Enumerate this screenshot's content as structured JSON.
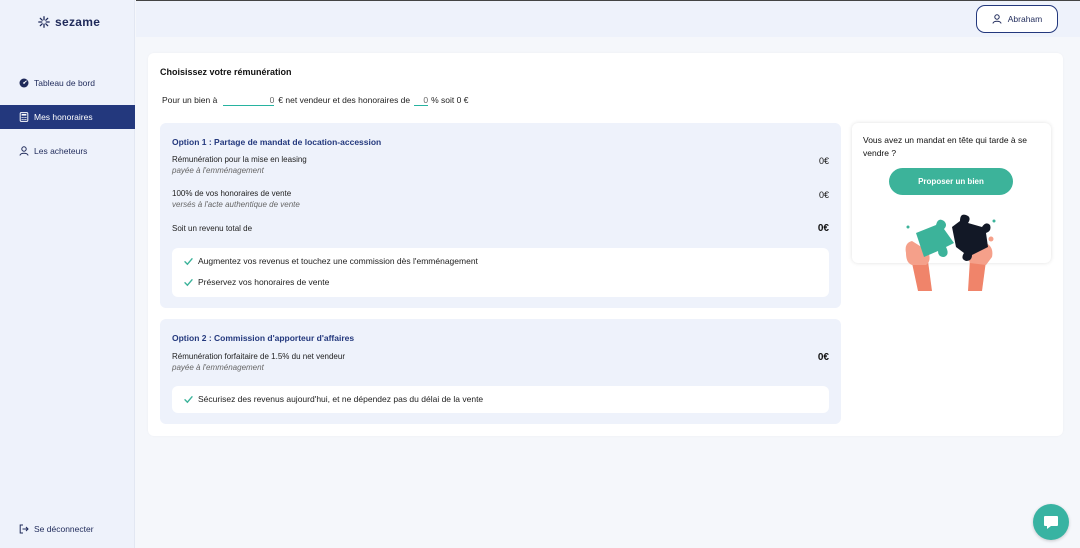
{
  "brand": {
    "name": "sezame"
  },
  "sidebar": {
    "items": [
      {
        "label": "Tableau de bord",
        "icon": "gauge-icon"
      },
      {
        "label": "Mes honoraires",
        "icon": "calculator-icon"
      },
      {
        "label": "Les acheteurs",
        "icon": "user-icon"
      }
    ],
    "logout_label": "Se déconnecter"
  },
  "header": {
    "user_name": "Abraham"
  },
  "main": {
    "title": "Choisissez votre rémunération",
    "calc": {
      "prefix": "Pour un bien à",
      "price_value": "0",
      "middle": "€ net vendeur et des honoraires de",
      "pct_value": "0",
      "suffix": "% soit 0 €"
    },
    "option1": {
      "title": "Option 1 : Partage de mandat de location-accession",
      "line1": "Rémunération pour la mise en leasing",
      "line1_sub": "payée à l'emménagement",
      "line1_value": "0€",
      "line2": "100% de vos honoraires de vente",
      "line2_sub": "versés à l'acte authentique de vente",
      "line2_value": "0€",
      "total_label": "Soit un revenu total de",
      "total_value": "0€",
      "benefits": [
        "Augmentez vos revenus et touchez une commission dès l'emménagement",
        "Préservez vos honoraires de vente"
      ]
    },
    "option2": {
      "title": "Option 2 : Commission d'apporteur d'affaires",
      "line1": "Rémunération forfaitaire de 1.5% du net vendeur",
      "line1_sub": "payée à l'emménagement",
      "line1_value": "0€",
      "benefits": [
        "Sécurisez des revenus aujourd'hui, et ne dépendez pas du délai de la vente"
      ]
    }
  },
  "side_card": {
    "text": "Vous avez un mandat en tête qui tarde à se vendre ?",
    "button_label": "Proposer un bien"
  },
  "colors": {
    "primary": "#23387d",
    "accent": "#3cb39a",
    "panel": "#eef2fb"
  }
}
